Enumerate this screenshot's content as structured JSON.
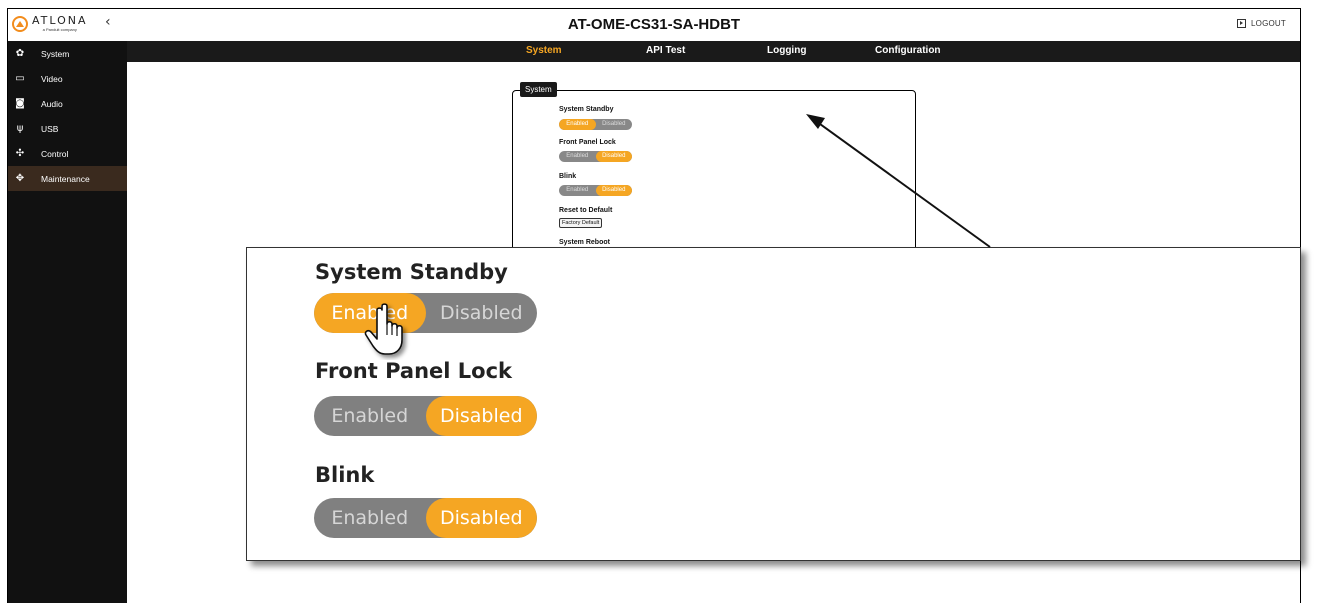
{
  "header": {
    "brand": "ATLONA",
    "brand_sub": "a Panduit company",
    "collapse_glyph": "‹",
    "model": "AT-OME-CS31-SA-HDBT",
    "logout_label": "LOGOUT"
  },
  "nav": {
    "tabs": [
      {
        "label": "System",
        "active": true
      },
      {
        "label": "API Test",
        "active": false
      },
      {
        "label": "Logging",
        "active": false
      },
      {
        "label": "Configuration",
        "active": false
      }
    ]
  },
  "sidebar": {
    "items": [
      {
        "label": "System",
        "icon": "gear-icon"
      },
      {
        "label": "Video",
        "icon": "monitor-icon"
      },
      {
        "label": "Audio",
        "icon": "audio-icon"
      },
      {
        "label": "USB",
        "icon": "usb-icon"
      },
      {
        "label": "Control",
        "icon": "control-icon"
      },
      {
        "label": "Maintenance",
        "icon": "maintenance-icon",
        "active": true
      }
    ]
  },
  "panel": {
    "legend": "System",
    "system_standby": {
      "label": "System Standby",
      "options": [
        "Enabled",
        "Disabled"
      ],
      "selected": "Enabled"
    },
    "front_panel_lock": {
      "label": "Front Panel Lock",
      "options": [
        "Enabled",
        "Disabled"
      ],
      "selected": "Disabled"
    },
    "blink": {
      "label": "Blink",
      "options": [
        "Enabled",
        "Disabled"
      ],
      "selected": "Disabled"
    },
    "reset": {
      "label": "Reset to Default",
      "button": "Factory Default"
    },
    "reboot": {
      "label": "System Reboot"
    }
  },
  "zoom": {
    "system_standby": {
      "label": "System Standby",
      "options": [
        "Enabled",
        "Disabled"
      ],
      "selected": "Enabled"
    },
    "front_panel_lock": {
      "label": "Front Panel Lock",
      "options": [
        "Enabled",
        "Disabled"
      ],
      "selected": "Disabled"
    },
    "blink": {
      "label": "Blink",
      "options": [
        "Enabled",
        "Disabled"
      ],
      "selected": "Disabled"
    }
  },
  "colors": {
    "accent": "#f5a623",
    "sidebar_bg": "#111111",
    "navbar_bg": "#1a1a1a",
    "toggle_off": "#808080"
  }
}
